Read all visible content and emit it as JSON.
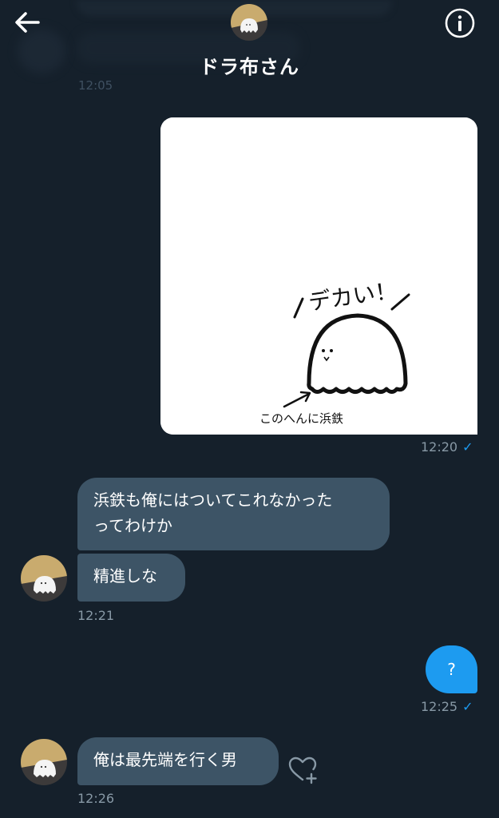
{
  "header": {
    "title": "ドラ布さん",
    "back_icon": "arrow-left-icon",
    "info_icon": "info-icon"
  },
  "background_previous": {
    "time": "12:05"
  },
  "image_message": {
    "drawing_text_top": "デカい！",
    "drawing_text_bottom": "このへんに浜鉄",
    "time": "12:20",
    "status_icon": "check-icon"
  },
  "incoming_1": {
    "text_line1": "浜鉄も俺にはついてこれなかった",
    "text_line2": "ってわけか",
    "text2": "精進しな",
    "time": "12:21"
  },
  "outgoing_2": {
    "text": "?",
    "time": "12:25",
    "status_icon": "check-icon"
  },
  "incoming_2": {
    "text": "俺は最先端を行く男",
    "time": "12:26",
    "reaction_icon": "heart-plus-icon"
  },
  "colors": {
    "background": "#15202b",
    "incoming_bubble": "#3d5466",
    "outgoing_bubble": "#1d9bf0",
    "timestamp": "#8899a6",
    "check": "#1d9bf0"
  }
}
